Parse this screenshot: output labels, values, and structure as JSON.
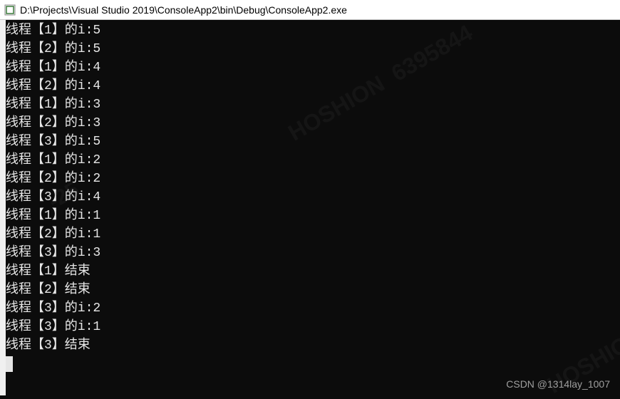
{
  "window": {
    "title": "D:\\Projects\\Visual Studio 2019\\ConsoleApp2\\bin\\Debug\\ConsoleApp2.exe"
  },
  "console": {
    "lines": [
      "线程【1】的i:5",
      "线程【2】的i:5",
      "线程【1】的i:4",
      "线程【2】的i:4",
      "线程【1】的i:3",
      "线程【2】的i:3",
      "线程【3】的i:5",
      "线程【1】的i:2",
      "线程【2】的i:2",
      "线程【3】的i:4",
      "线程【1】的i:1",
      "线程【2】的i:1",
      "线程【3】的i:3",
      "线程【1】结束",
      "线程【2】结束",
      "线程【3】的i:2",
      "线程【3】的i:1",
      "线程【3】结束"
    ]
  },
  "watermark": {
    "csdn": "CSDN @1314lay_1007",
    "diag_name": "HOSHION",
    "diag_num": "6395844",
    "diag_date": "-25"
  }
}
